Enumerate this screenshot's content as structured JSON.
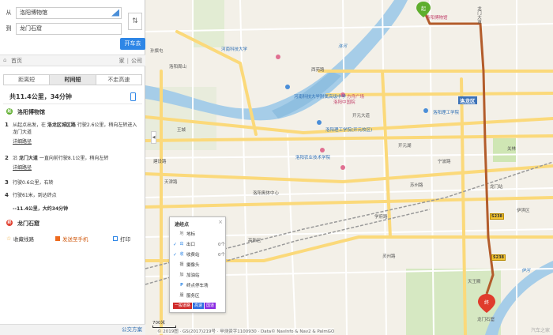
{
  "route": {
    "from_prefix": "从",
    "from_value": "洛阳博物馆",
    "to_prefix": "到",
    "to_value": "龙门石窟",
    "go_button": "开车去"
  },
  "home": {
    "label": "首页",
    "links": [
      "家",
      "公司"
    ],
    "separator": "|"
  },
  "tabs": [
    {
      "label": "距离短"
    },
    {
      "label": "时间短",
      "active": true
    },
    {
      "label": "不走高速"
    }
  ],
  "summary": "共11.4公里，34分钟",
  "start": {
    "marker": "起",
    "name": "洛阳博物馆"
  },
  "end": {
    "marker": "终",
    "name": "龙门石窟"
  },
  "steps": [
    {
      "num": "1",
      "text_a": "从起点出发，在 ",
      "bold_a": "洛龙区城区路",
      "text_b": " 行驶2.6公里，稍向左转进入龙门大道",
      "detail": "详细路径"
    },
    {
      "num": "2",
      "text_a": "沿 ",
      "bold_a": "龙门大道",
      "text_b": " 一直向前行驶8.1公里，稍向左转",
      "detail": "详细路径"
    },
    {
      "num": "3",
      "text_a": "行驶0.6公里，右转",
      "bold_a": "",
      "text_b": "",
      "detail": ""
    },
    {
      "num": "4",
      "text_a": "行驶61米，到达终点",
      "bold_a": "",
      "text_b": "",
      "detail": ""
    }
  ],
  "total": "--11.4公里，大约34分钟",
  "actions": {
    "save": "收藏线路",
    "send": "发送至手机",
    "print": "打印"
  },
  "bottom_link": "公交方案",
  "map": {
    "labels": {
      "road_luoyang_dadao": "龙门大道",
      "river": "洛河",
      "district": "洛龙区",
      "kaiyuan": "开元大道",
      "museum_poi": "洛阳博物馆",
      "fangzhou": "方舟广场",
      "zhongguo": "洛阳中国院",
      "hkd": "河南科技大学",
      "hkd_high": "河南科技大学附属高级中学",
      "lit": "洛阳理工学院(开元校区)",
      "lit2": "洛阳理工学院",
      "nongye": "洛阳农业技术学院",
      "xiyuan": "西苑路",
      "jianshe": "建设路",
      "longmen_st": "龙门石窟",
      "longmen_mid": "龙门站",
      "guan": "关林",
      "tianjin": "天津路",
      "wang": "王城",
      "kaiyuanhu": "开元湖",
      "luoyang_bus": "洛阳奥体中心",
      "zhoushan": "洛阳周山",
      "sunqi": "孙旗屯",
      "xuefu": "学府路",
      "yiwai": "伊河",
      "gaoxin": "高新区",
      "ningbo": "宁波路",
      "yicheng": "伊滨区",
      "suzhou": "苏州路",
      "lingzhou": "灵州路",
      "tianwang": "天王殿",
      "s238": "S238",
      "s238b": "S238"
    }
  },
  "legend": {
    "title": "途经点",
    "close": "×",
    "rows": [
      {
        "check": "",
        "icon": "地",
        "name": "地标",
        "count": ""
      },
      {
        "check": "✓",
        "icon": "出",
        "name": "出口",
        "count": "0个"
      },
      {
        "check": "✓",
        "icon": "收",
        "name": "收费站",
        "count": "0个"
      },
      {
        "check": "",
        "icon": "摄",
        "name": "摄像头",
        "count": ""
      },
      {
        "check": "",
        "icon": "加",
        "name": "加油站",
        "count": ""
      },
      {
        "check": "",
        "icon": "P",
        "name": "终点停车场",
        "count": ""
      },
      {
        "check": "",
        "icon": "服",
        "name": "服务区",
        "count": ""
      }
    ],
    "tags": [
      "一般道路",
      "高速",
      "国道"
    ]
  },
  "scale": "700米",
  "copyright": "© 2019图 · GS(2017)219号 · 甲测资字1100930 · Data© NavInfo & Nav2 & PalmGO",
  "watermark": "汽车之家",
  "colors": {
    "route": "#b35c2b",
    "water": "#a6cde8",
    "green": "#cfe6b4",
    "major_road": "#fbd97a",
    "accent_blue": "#2e86e6"
  }
}
